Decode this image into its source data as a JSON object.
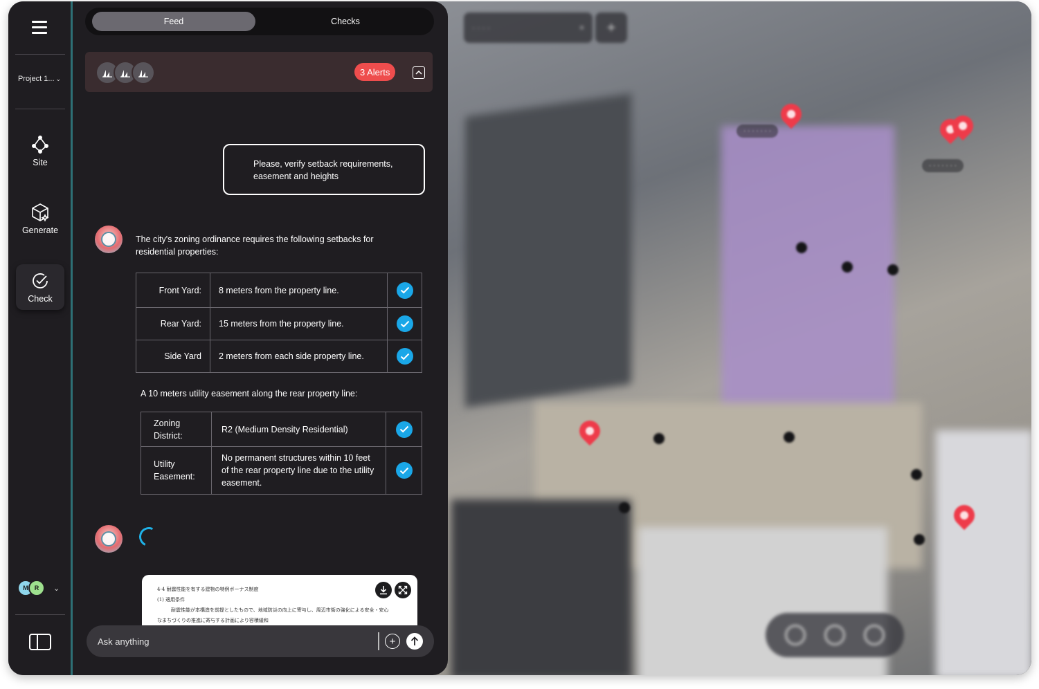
{
  "rail": {
    "project_label": "Project 1...",
    "items": [
      {
        "label": "Site",
        "icon": "site-nodes-icon"
      },
      {
        "label": "Generate",
        "icon": "generate-cube-icon"
      },
      {
        "label": "Check",
        "icon": "check-circle-icon",
        "active": true
      }
    ],
    "avatars": [
      "M",
      "R"
    ]
  },
  "tabs": [
    {
      "label": "Feed",
      "active": true
    },
    {
      "label": "Checks",
      "active": false
    }
  ],
  "alerts": {
    "badge": "3 Alerts",
    "badge_color": "#ee4d4d"
  },
  "user_message": "Please, verify setback requirements, easement and heights",
  "bot_message": "The city's zoning ordinance requires the following setbacks for residential properties:",
  "setbacks": [
    {
      "label": "Front Yard:",
      "value": "8 meters from the property line.",
      "status": "check"
    },
    {
      "label": "Rear Yard:",
      "value": "15 meters from the property line.",
      "status": "check"
    },
    {
      "label": "Side Yard",
      "value": "2 meters from each side property line.",
      "status": "check"
    }
  ],
  "easement_intro": "A 10 meters utility easement along the rear property line:",
  "easement": [
    {
      "label": "Zoning District:",
      "value": "R2 (Medium Density Residential)",
      "status": "check"
    },
    {
      "label": "Utility Easement:",
      "value": "No permanent structures within 10 feet of the rear property line due to the utility easement.",
      "status": "check"
    }
  ],
  "doc_preview": {
    "lines": [
      "4-4 耐震性能を有する建物の特例ボーナス制度",
      "(1) 適用条件",
      "耐震性能が本構造を前提としたもので、地域防災の向上に寄与し、周辺市街の強化による安全・安心",
      "なまちづくりの推進に寄与する計画により容積緩和"
    ]
  },
  "composer": {
    "placeholder": "Ask anything"
  },
  "colors": {
    "accent": "#1aa7e8",
    "alert": "#ee4d4d",
    "rail_divider": "#2d6f75",
    "panel_bg": "#1f1d21"
  }
}
